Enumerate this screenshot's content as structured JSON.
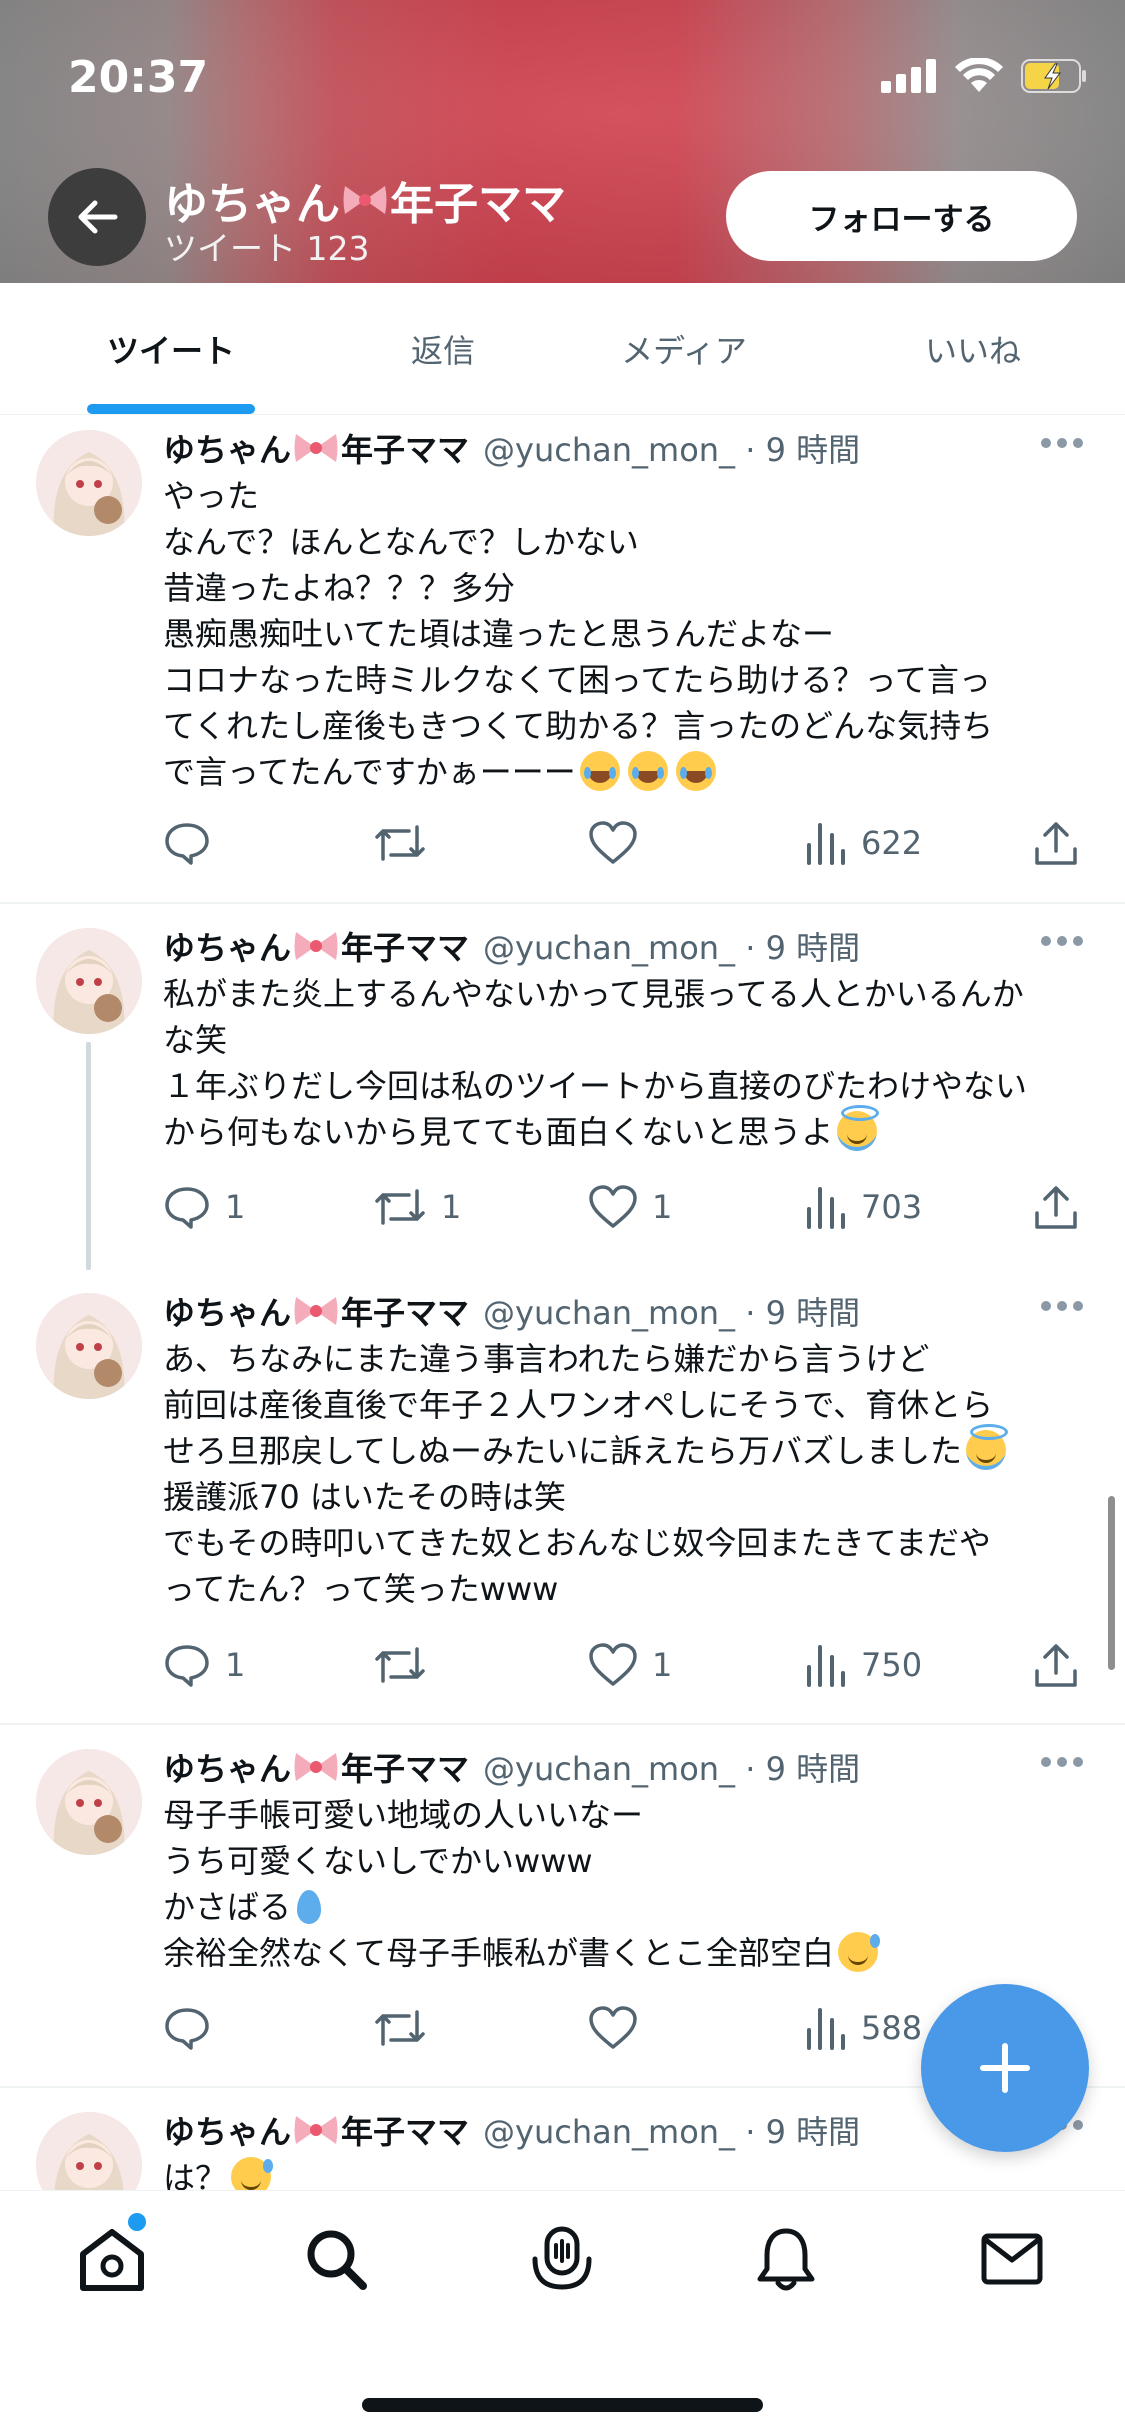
{
  "status_bar": {
    "time": "20:37"
  },
  "header": {
    "name": "ゆちゃん🎀年子ママ",
    "name_part1": "ゆちゃん",
    "name_part2": "年子ママ",
    "tweet_count": "ツイート 123",
    "follow_label": "フォローする"
  },
  "tabs": [
    {
      "label": "ツイート",
      "active": true
    },
    {
      "label": "返信"
    },
    {
      "label": "メディア"
    },
    {
      "label": "いいね"
    }
  ],
  "tweets": [
    {
      "name_part1": "ゆちゃん",
      "name_part2": "年子ママ",
      "handle": "@yuchan_mon_ · 9 時間",
      "lines": [
        "やった",
        "なんで？ほんとなんで？しかない",
        "昔違ったよね？？？多分",
        "愚痴愚痴吐いてた頃は違ったと思うんだよなー",
        "コロナなった時ミルクなくて困ってたら助ける？って言っ",
        "てくれたし産後もきつくて助かる？言ったのどんな気持ち",
        "で言ってたんですかぁーーー"
      ],
      "reply": "",
      "retweet": "",
      "like": "",
      "views": "622"
    },
    {
      "name_part1": "ゆちゃん",
      "name_part2": "年子ママ",
      "handle": "@yuchan_mon_ · 9 時間",
      "lines": [
        "私がまた炎上するんやないかって見張ってる人とかいるんか",
        "な笑",
        "１年ぶりだし今回は私のツイートから直接のびたわけやない",
        "から何もないから見てても面白くないと思うよ"
      ],
      "reply": "1",
      "retweet": "1",
      "like": "1",
      "views": "703"
    },
    {
      "name_part1": "ゆちゃん",
      "name_part2": "年子ママ",
      "handle": "@yuchan_mon_ · 9 時間",
      "lines": [
        "あ、ちなみにまた違う事言われたら嫌だから言うけど",
        "前回は産後直後で年子２人ワンオペしにそうで、育休とら",
        "せろ旦那戻してしぬーみたいに訴えたら万バズしました",
        "援護派70 はいたその時は笑",
        "でもその時叩いてきた奴とおんなじ奴今回またきてまだや",
        "ってたん？って笑ったwww"
      ],
      "reply": "1",
      "retweet": "",
      "like": "1",
      "views": "750"
    },
    {
      "name_part1": "ゆちゃん",
      "name_part2": "年子ママ",
      "handle": "@yuchan_mon_ · 9 時間",
      "lines": [
        "母子手帳可愛い地域の人いいなー",
        "うち可愛くないしでかいwww",
        "かさばる",
        "余裕全然なくて母子手帳私が書くとこ全部空白"
      ],
      "reply": "",
      "retweet": "",
      "like": "",
      "views": "588"
    },
    {
      "name_part1": "ゆちゃん",
      "name_part2": "年子ママ",
      "handle": "@yuchan_mon_ · 9 時間",
      "lines": [
        "は？"
      ]
    }
  ],
  "icons": {
    "back": "arrow-left-icon",
    "reply": "comment-icon",
    "retweet": "retweet-icon",
    "like": "heart-icon",
    "views": "bar-chart-icon",
    "share": "share-icon",
    "more": "more-dots-icon",
    "compose": "plus-icon",
    "nav": [
      "home-icon",
      "search-icon",
      "spaces-icon",
      "bell-icon",
      "mail-icon"
    ]
  },
  "colors": {
    "accent": "#1d9bf0",
    "fab": "#4a99e9",
    "secondary_text": "#536471",
    "banner_red": "#cf3d4b"
  }
}
